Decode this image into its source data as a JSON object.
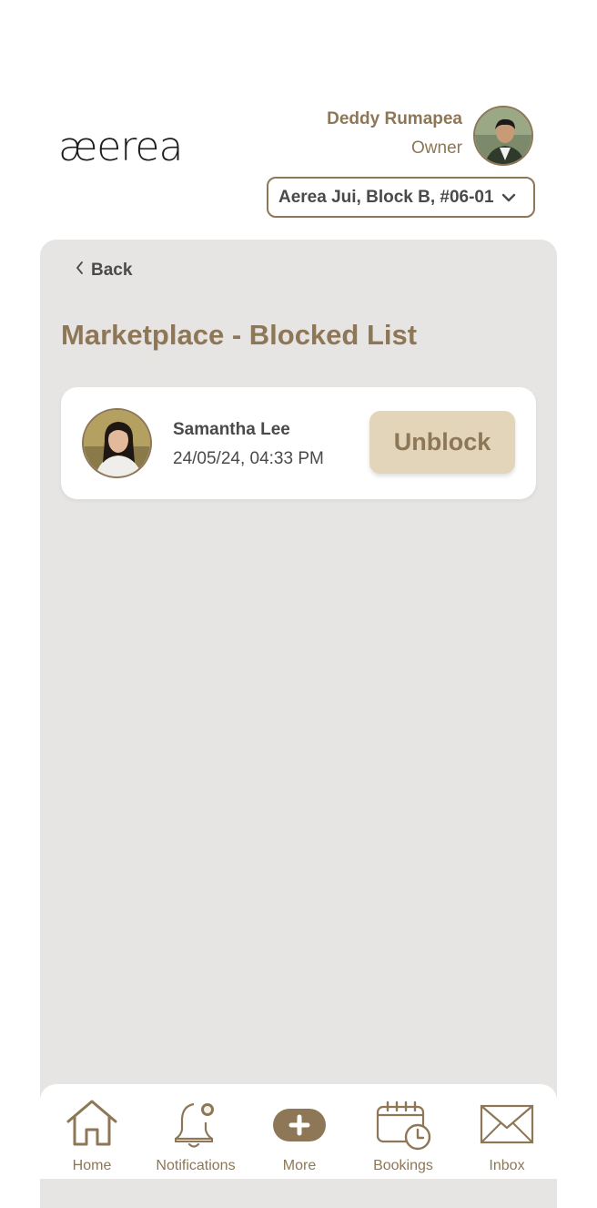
{
  "header": {
    "logo_text": "æerea",
    "user_name": "Deddy Rumapea",
    "user_role": "Owner",
    "avatar_icon": "user-avatar-photo",
    "unit_selector": "Aerea Jui, Block B, #06-01"
  },
  "page": {
    "back_label": "Back",
    "title": "Marketplace - Blocked List"
  },
  "blocked_users": [
    {
      "name": "Samantha Lee",
      "blocked_at": "24/05/24, 04:33 PM",
      "action_label": "Unblock"
    }
  ],
  "bottom_nav": {
    "items": [
      {
        "label": "Home",
        "icon": "home-icon"
      },
      {
        "label": "Notifications",
        "icon": "bell-icon"
      },
      {
        "label": "More",
        "icon": "plus-icon"
      },
      {
        "label": "Bookings",
        "icon": "calendar-clock-icon"
      },
      {
        "label": "Inbox",
        "icon": "envelope-icon"
      }
    ]
  },
  "colors": {
    "accent": "#8d7757",
    "button_bg": "#e3d5b9",
    "panel_bg": "#e6e5e3",
    "text": "#4a4a4a"
  }
}
